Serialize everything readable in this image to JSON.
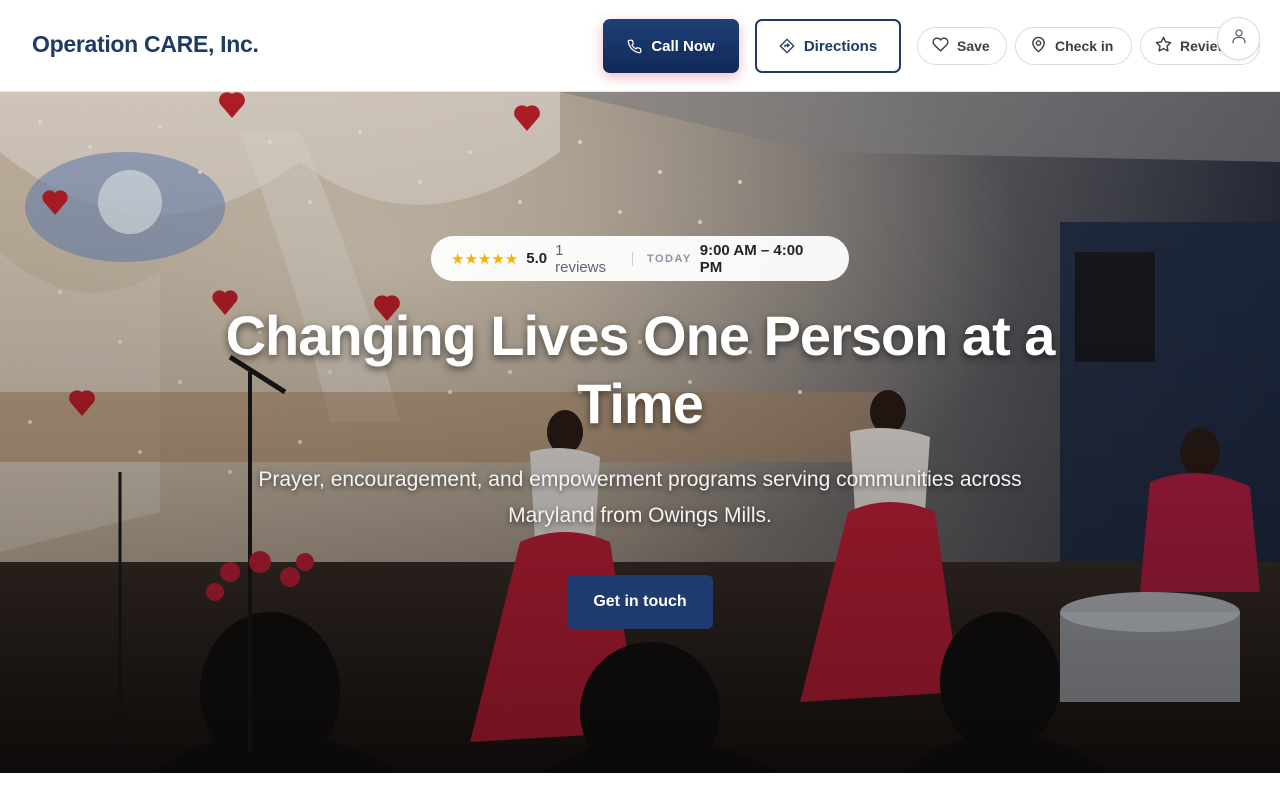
{
  "header": {
    "brand": "Operation CARE, Inc.",
    "call_label": "Call Now",
    "directions_label": "Directions",
    "save_label": "Save",
    "checkin_label": "Check in",
    "review_label": "Review"
  },
  "hero": {
    "stars": "★★★★★",
    "rating": "5.0",
    "reviews": "1 reviews",
    "today_label": "TODAY",
    "hours": "9:00 AM – 4:00 PM",
    "headline": "Changing Lives One Person at a Time",
    "subline": "Prayer, encouragement, and empowerment programs serving communities across Maryland from Owings Mills.",
    "cta_label": "Get in touch"
  },
  "icons": {
    "call": "phone-icon",
    "directions": "directions-icon",
    "save": "heart-icon",
    "checkin": "map-pin-icon",
    "review": "star-icon",
    "account": "user-icon"
  },
  "colors": {
    "brand": "#1e3a66",
    "primary_button": "#1e3f78",
    "cta": "#1e3a6e",
    "star": "#f5b301"
  }
}
